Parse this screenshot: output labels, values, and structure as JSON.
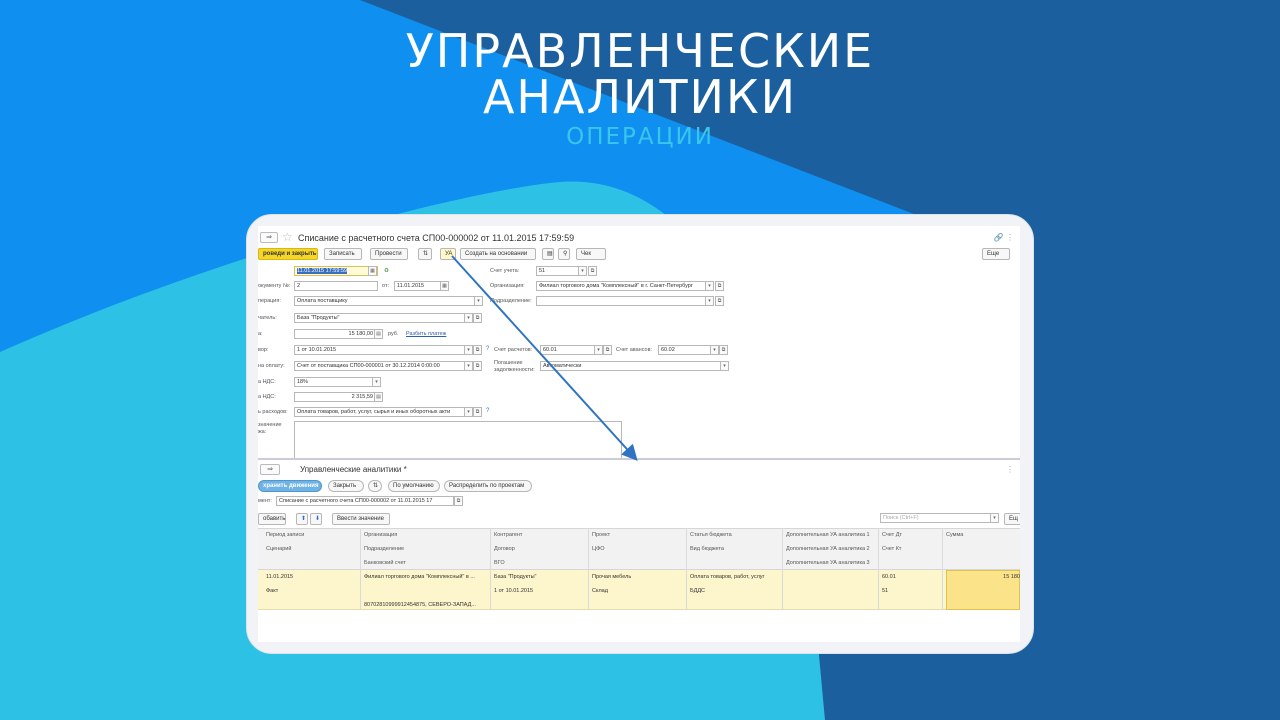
{
  "slide": {
    "title_line1": "УПРАВЛЕНЧЕСКИЕ",
    "title_line2": "АНАЛИТИКИ",
    "subtitle": "ОПЕРАЦИИ",
    "colors": {
      "dark_blue": "#1b5f9e",
      "bright_blue": "#0f8ff0",
      "cyan": "#2ec1e6",
      "subtitle": "#38c6ea"
    }
  },
  "doc": {
    "nav_forward": "⇒",
    "title": "Списание с расчетного счета СП00-000002 от 11.01.2015 17:59:59",
    "toolbar": {
      "post_close": "роведи и закрыть",
      "save": "Записать",
      "post": "Провести",
      "ua": "УА",
      "create_based": "Создать на основании",
      "check": "Чек",
      "more": "Еще"
    },
    "fields": {
      "date_value": "11.01.2015 17:59:59",
      "doc_no_label": "окументу №:",
      "doc_no_value": "2",
      "from_label": "от:",
      "from_value": "11.01.2015",
      "operation_label": "перация:",
      "operation_value": "Оплата поставщику",
      "payee_label": "чатель:",
      "payee_value": "База \"Продукты\"",
      "amount_label": "а:",
      "amount_value": "15 180,00",
      "currency": "руб.",
      "split_link": "Разбить платеж",
      "contract_label": "вор:",
      "contract_value": "1 от 10.01.2015",
      "invoice_label": "на оплату:",
      "invoice_value": "Счет от поставщика СП00-000001 от 30.12.2014 0:00:00",
      "vat_rate_label": "а НДС:",
      "vat_rate_value": "18%",
      "vat_sum_label": "а НДС:",
      "vat_sum_value": "2 315,59",
      "expense_label": "ь расходов:",
      "expense_value": "Оплата товаров, работ, услуг, сырья и иных оборотных акти",
      "comment_label": "значение\nжа:",
      "account_label": "Счет учета:",
      "account_value": "51",
      "org_label": "Организация:",
      "org_value": "Филиал торгового дома \"Комплексный\" в г. Санкт-Петербург",
      "division_label": "Подразделение:",
      "division_value": "",
      "settle_acc_label": "Счет расчетов:",
      "settle_acc_value": "60.01",
      "advance_acc_label": "Счет авансов:",
      "advance_acc_value": "60.02",
      "repay_label": "Погашение задолженности:",
      "repay_value": "Автоматически"
    }
  },
  "ua": {
    "nav_forward": "⇒",
    "title": "Управленческие аналитики *",
    "buttons": {
      "record_moves": "хранить движения",
      "close": "Закрыть",
      "defaults": "По умолчанию",
      "distribute": "Распределить по проектам",
      "add": "обавить",
      "input_value": "Ввести значение",
      "more": "Ещ"
    },
    "document_label": "мент:",
    "document_value": "Списание с расчетного счета СП00-000002 от 11.01.2015 17",
    "search_placeholder": "Поиск (Ctrl+F)",
    "columns": [
      [
        "Период записи",
        "Сценарий",
        ""
      ],
      [
        "Организация",
        "Подразделение",
        "Банковский счет"
      ],
      [
        "Контрагент",
        "Договор",
        "ВГО"
      ],
      [
        "Проект",
        "ЦФО",
        ""
      ],
      [
        "Статья бюджета",
        "Вид бюджета",
        ""
      ],
      [
        "Дополнительная УА аналитика 1",
        "Дополнительная УА аналитика 2",
        "Дополнительная УА аналитика 3"
      ],
      [
        "Счет Дт",
        "Счет Кт",
        ""
      ],
      [
        "Сумма",
        "",
        ""
      ]
    ],
    "row": [
      [
        "11.01.2015",
        "Факт",
        ""
      ],
      [
        "Филиал торгового дома \"Комплексный\" в ...",
        "",
        "80702810999912454875, СЕВЕРО-ЗАПАД..."
      ],
      [
        "База \"Продукты\"",
        "1 от 10.01.2015",
        ""
      ],
      [
        "Прочая мебель",
        "Склад",
        ""
      ],
      [
        "Оплата товаров, работ, услуг",
        "БДДС",
        ""
      ],
      [
        "",
        "",
        ""
      ],
      [
        "60.01",
        "51",
        ""
      ],
      [
        "15 180",
        "",
        ""
      ]
    ]
  }
}
